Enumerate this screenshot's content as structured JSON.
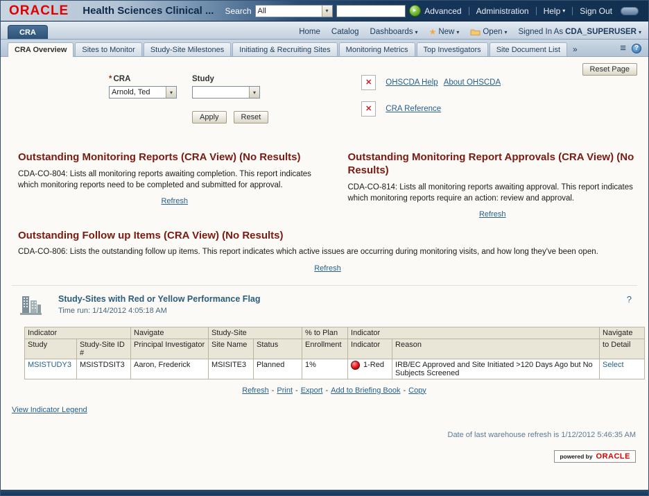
{
  "icons": {
    "chevron_down": "▾",
    "go_arrow": "►",
    "star": "★",
    "overflow": "»",
    "help_q": "?",
    "menu": "≡",
    "broken_x": "✕"
  },
  "header": {
    "logo": "ORACLE",
    "title": "Health Sciences Clinical ...",
    "search_label": "Search",
    "search_scope": "All",
    "search_value": "",
    "advanced": "Advanced",
    "administration": "Administration",
    "help": "Help",
    "sign_out": "Sign Out"
  },
  "groupbar": {
    "group_tab": "CRA",
    "home": "Home",
    "catalog": "Catalog",
    "dashboards": "Dashboards",
    "new": "New",
    "open": "Open",
    "signed_in_as": "Signed In As",
    "user": "CDA_SUPERUSER"
  },
  "tabs": {
    "items": [
      "CRA Overview",
      "Sites to Monitor",
      "Study-Site Milestones",
      "Initiating & Recruiting Sites",
      "Monitoring Metrics",
      "Top Investigators",
      "Site Document List"
    ]
  },
  "toolbar": {
    "reset_page": "Reset Page"
  },
  "filters": {
    "required_marker": "*",
    "cra_label": "CRA",
    "cra_value": "Arnold, Ted",
    "study_label": "Study",
    "study_value": "",
    "apply": "Apply",
    "reset": "Reset"
  },
  "quicklinks": {
    "ohscda_help": "OHSCDA Help",
    "about_ohscda": "About OHSCDA",
    "cra_reference": "CRA Reference"
  },
  "sections": {
    "monitoring_reports": {
      "title": "Outstanding Monitoring Reports (CRA View) (No Results)",
      "description": "CDA-CO-804: Lists all monitoring reports awaiting completion. This report indicates which monitoring reports need to be completed and submitted for approval.",
      "refresh": "Refresh"
    },
    "report_approvals": {
      "title": "Outstanding Monitoring Report Approvals (CRA View) (No Results)",
      "description": "CDA-CO-814: Lists all monitoring reports awaiting approval. This report indicates which monitoring reports require an action: review and approval.",
      "refresh": "Refresh"
    },
    "followup_items": {
      "title": "Outstanding Follow up Items (CRA View) (No Results)",
      "description": "CDA-CO-806: Lists the outstanding follow up items. This report indicates which active issues are occurring during monitoring visits, and how long they've been open.",
      "refresh": "Refresh"
    }
  },
  "flag_report": {
    "title": "Study-Sites with Red or Yellow Performance Flag",
    "time_run": "Time run: 1/14/2012 4:05:18 AM",
    "help": "?"
  },
  "table": {
    "group_headers": [
      "Indicator",
      "Navigate",
      "Study-Site",
      "% to Plan",
      "Indicator",
      "Navigate"
    ],
    "columns": [
      "Study",
      "Study-Site ID #",
      "Principal Investigator",
      "Site Name",
      "Status",
      "Enrollment",
      "Indicator",
      "Reason",
      "to Detail"
    ],
    "rows": [
      {
        "study": "MSISTUDY3",
        "study_site_id": "MSISTDSIT3",
        "principal_investigator": "Aaron, Frederick",
        "site_name": "MSISITE3",
        "status": "Planned",
        "enrollment": "1%",
        "indicator": "1-Red",
        "reason": "IRB/EC Approved and Site Initiated >120 Days Ago but No Subjects Screened",
        "navigate": "Select"
      }
    ]
  },
  "report_actions": {
    "refresh": "Refresh",
    "print": "Print",
    "export": "Export",
    "add_to_briefing_book": "Add to Briefing Book",
    "copy": "Copy",
    "separator": "-"
  },
  "footer": {
    "view_indicator_legend": "View Indicator Legend",
    "warehouse_refresh": "Date of last warehouse refresh is 1/12/2012 5:46:35 AM",
    "powered_by": "powered by",
    "oracle": "ORACLE"
  }
}
